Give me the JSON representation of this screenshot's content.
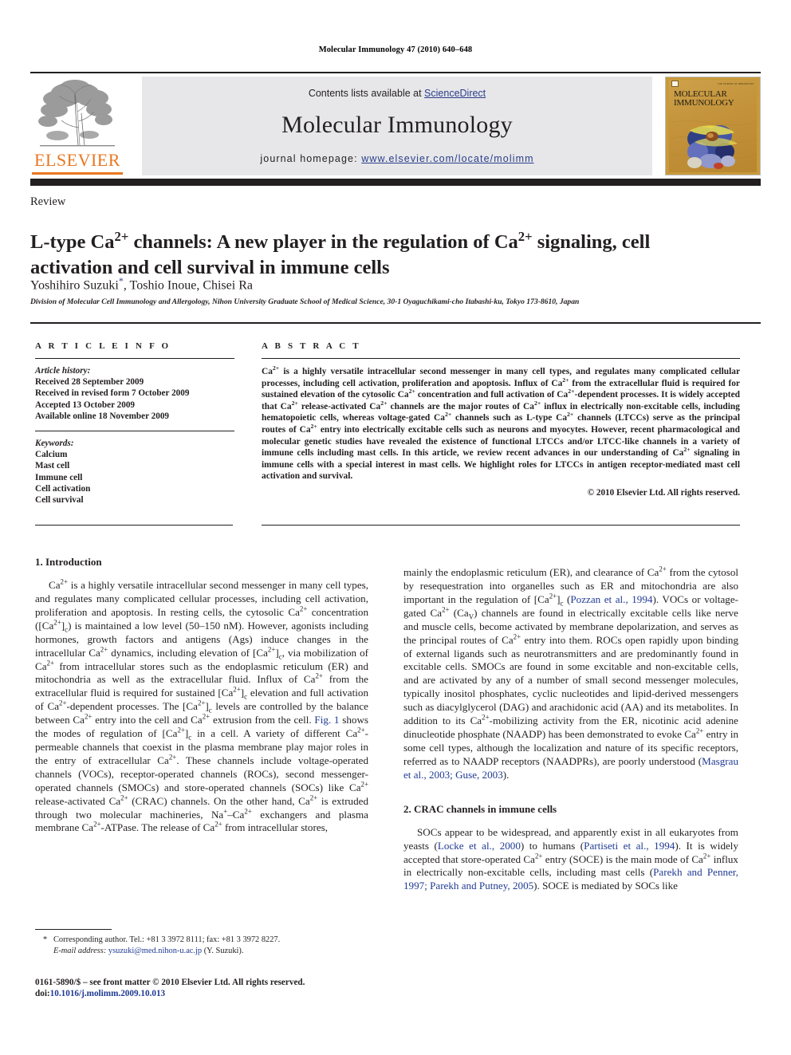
{
  "running_head": "Molecular Immunology 47 (2010) 640–648",
  "masthead": {
    "contents_prefix": "Contents lists available at ",
    "sciencedirect": "ScienceDirect",
    "journal_title": "Molecular Immunology",
    "homepage_prefix": "journal homepage:",
    "homepage_url": "www.elsevier.com/locate/molimm",
    "publisher_wordmark": "ELSEVIER",
    "cover_title_line1": "MOLECULAR",
    "cover_title_line2": "IMMUNOLOGY",
    "cover_masthead_tiny": "THE JOURNAL OF IMMUNOLOGY",
    "colors": {
      "band_background": "#e7e7e9",
      "link_blue": "#2a3e8c",
      "elsevier_orange": "#e87722",
      "rule_black": "#231f20",
      "cover_gold": "#c89a3c"
    }
  },
  "article": {
    "type": "Review",
    "title_html": "L-type Ca<sup>2+</sup> channels: A new player in the regulation of Ca<sup>2+</sup> signaling, cell activation and cell survival in immune cells",
    "authors_html": "Yoshihiro Suzuki<span class=\"star\">*</span>, Toshio Inoue, Chisei Ra",
    "affiliation": "Division of Molecular Cell Immunology and Allergology, Nihon University Graduate School of Medical Science, 30-1 Oyaguchikami-cho Itabashi-ku, Tokyo 173-8610, Japan"
  },
  "article_info": {
    "heading": "A R T I C L E   I N F O",
    "history_label": "Article history:",
    "history": [
      "Received 28 September 2009",
      "Received in revised form 7 October 2009",
      "Accepted 13 October 2009",
      "Available online 18 November 2009"
    ],
    "keywords_label": "Keywords:",
    "keywords": [
      "Calcium",
      "Mast cell",
      "Immune cell",
      "Cell activation",
      "Cell survival"
    ]
  },
  "abstract": {
    "heading": "A B S T R A C T",
    "text_html": "Ca<sup>2+</sup> is a highly versatile intracellular second messenger in many cell types, and regulates many complicated cellular processes, including cell activation, proliferation and apoptosis. Influx of Ca<sup>2+</sup> from the extracellular fluid is required for sustained elevation of the cytosolic Ca<sup>2+</sup> concentration and full activation of Ca<sup>2+</sup>-dependent processes. It is widely accepted that Ca<sup>2+</sup> release-activated Ca<sup>2+</sup> channels are the major routes of Ca<sup>2+</sup> influx in electrically non-excitable cells, including hematopoietic cells, whereas voltage-gated Ca<sup>2+</sup> channels such as L-type Ca<sup>2+</sup> channels (LTCCs) serve as the principal routes of Ca<sup>2+</sup> entry into electrically excitable cells such as neurons and myocytes. However, recent pharmacological and molecular genetic studies have revealed the existence of functional LTCCs and/or LTCC-like channels in a variety of immune cells including mast cells. In this article, we review recent advances in our understanding of Ca<sup>2+</sup> signaling in immune cells with a special interest in mast cells. We highlight roles for LTCCs in antigen receptor-mediated mast cell activation and survival.",
    "copyright": "© 2010 Elsevier Ltd. All rights reserved."
  },
  "body": {
    "section1_heading": "1. Introduction",
    "section1_para1_html": "Ca<sup>2+</sup> is a highly versatile intracellular second messenger in many cell types, and regulates many complicated cellular processes, including cell activation, proliferation and apoptosis. In resting cells, the cytosolic Ca<sup>2+</sup> concentration ([Ca<sup>2+</sup>]<sub>c</sub>) is maintained a low level (50–150 nM). However, agonists including hormones, growth factors and antigens (Ags) induce changes in the intracellular Ca<sup>2+</sup> dynamics, including elevation of [Ca<sup>2+</sup>]<sub>c</sub>, via mobilization of Ca<sup>2+</sup> from intracellular stores such as the endoplasmic reticulum (ER) and mitochondria as well as the extracellular fluid. Influx of Ca<sup>2+</sup> from the extracellular fluid is required for sustained [Ca<sup>2+</sup>]<sub>c</sub> elevation and full activation of Ca<sup>2+</sup>-dependent processes. The [Ca<sup>2+</sup>]<sub>c</sub> levels are controlled by the balance between Ca<sup>2+</sup> entry into the cell and Ca<sup>2+</sup> extrusion from the cell. <span class=\"cite\">Fig. 1</span> shows the modes of regulation of [Ca<sup>2+</sup>]<sub>c</sub> in a cell. A variety of different Ca<sup>2+</sup>-permeable channels that coexist in the plasma membrane play major roles in the entry of extracellular Ca<sup>2+</sup>. These channels include voltage-operated channels (VOCs), receptor-operated channels (ROCs), second messenger-operated channels (SMOCs) and store-operated channels (SOCs) like Ca<sup>2+</sup> release-activated Ca<sup>2+</sup> (CRAC) channels. On the other hand, Ca<sup>2+</sup> is extruded through two molecular machineries, Na<sup>+</sup>–Ca<sup>2+</sup> exchangers and plasma membrane Ca<sup>2+</sup>-ATPase. The release of Ca<sup>2+</sup> from intracellular stores,",
    "right_para1_html": "mainly the endoplasmic reticulum (ER), and clearance of Ca<sup>2+</sup> from the cytosol by resequestration into organelles such as ER and mitochondria are also important in the regulation of [Ca<sup>2+</sup>]<sub>c</sub> (<span class=\"cite\">Pozzan et al., 1994</span>). VOCs or voltage-gated Ca<sup>2+</sup> (Ca<sub>V</sub>) channels are found in electrically excitable cells like nerve and muscle cells, become activated by membrane depolarization, and serves as the principal routes of Ca<sup>2+</sup> entry into them. ROCs open rapidly upon binding of external ligands such as neurotransmitters and are predominantly found in excitable cells. SMOCs are found in some excitable and non-excitable cells, and are activated by any of a number of small second messenger molecules, typically inositol phosphates, cyclic nucleotides and lipid-derived messengers such as diacylglycerol (DAG) and arachidonic acid (AA) and its metabolites. In addition to its Ca<sup>2+</sup>-mobilizing activity from the ER, nicotinic acid adenine dinucleotide phosphate (NAADP) has been demonstrated to evoke Ca<sup>2+</sup> entry in some cell types, although the localization and nature of its specific receptors, referred as to NAADP receptors (NAADPRs), are poorly understood (<span class=\"cite\">Masgrau et al., 2003; Guse, 2003</span>).",
    "section2_heading": "2. CRAC channels in immune cells",
    "section2_para1_html": "SOCs appear to be widespread, and apparently exist in all eukaryotes from yeasts (<span class=\"cite\">Locke et al., 2000</span>) to humans (<span class=\"cite\">Partiseti et al., 1994</span>). It is widely accepted that store-operated Ca<sup>2+</sup> entry (SOCE) is the main mode of Ca<sup>2+</sup> influx in electrically non-excitable cells, including mast cells (<span class=\"cite\">Parekh and Penner, 1997; Parekh and Putney, 2005</span>). SOCE is mediated by SOCs like"
  },
  "footnotes": {
    "corresponding_marker": "*",
    "corresponding_html": "Corresponding author. Tel.: +81 3 3972 8111; fax: +81 3 3972 8227.",
    "email_label": "E-mail address:",
    "email": "ysuzuki@med.nihon-u.ac.jp",
    "email_suffix": "(Y. Suzuki).",
    "issn_line": "0161-5890/$ – see front matter © 2010 Elsevier Ltd. All rights reserved.",
    "doi_label": "doi:",
    "doi": "10.1016/j.molimm.2009.10.013"
  }
}
